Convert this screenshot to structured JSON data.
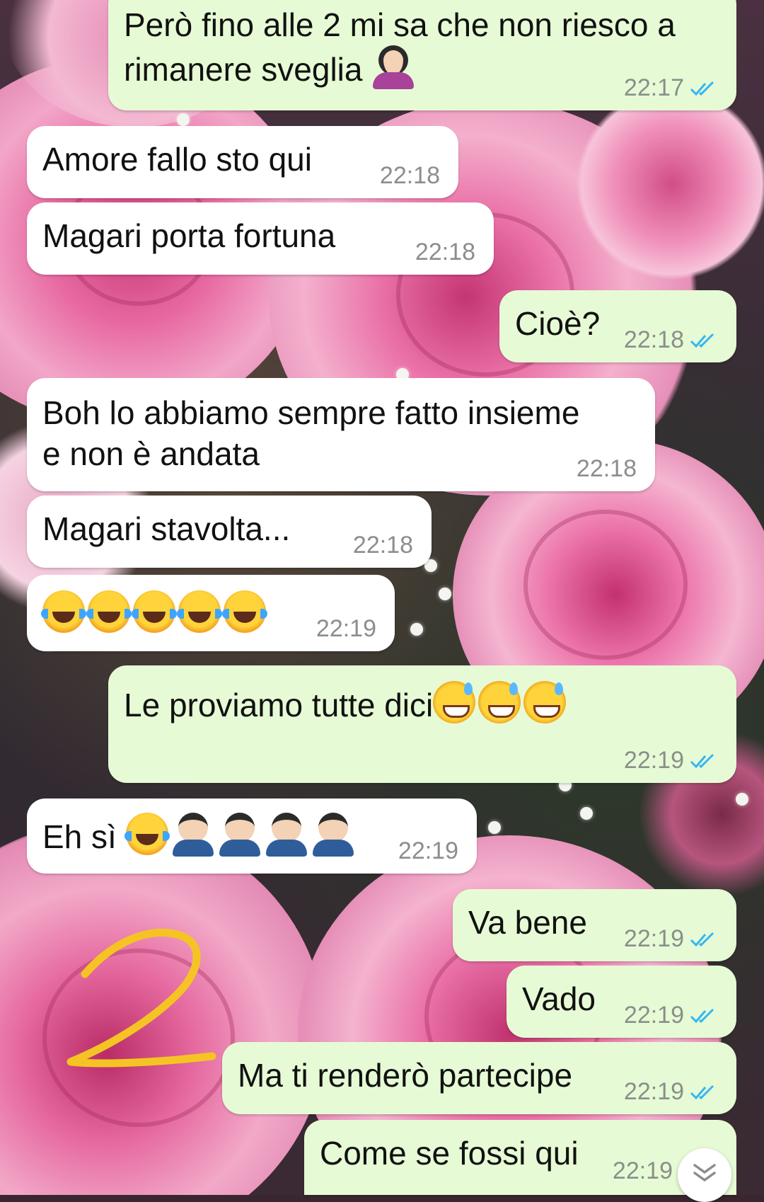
{
  "colors": {
    "incoming_bubble": "#ffffff",
    "outgoing_bubble": "#e6fbd5",
    "timestamp": "#8a8f8a",
    "read_ticks": "#34b7f1",
    "annotation": "#f5c424"
  },
  "messages": [
    {
      "direction": "out",
      "text": "Però fino alle 2 mi sa che non riesco a",
      "text2": "rimanere sveglia",
      "emoji": [
        "facepalm-woman"
      ],
      "time": "22:17",
      "status": "read"
    },
    {
      "direction": "in",
      "text": "Amore fallo sto qui",
      "time": "22:18"
    },
    {
      "direction": "in",
      "text": "Magari porta fortuna",
      "time": "22:18"
    },
    {
      "direction": "out",
      "text": "Cioè?",
      "time": "22:18",
      "status": "read"
    },
    {
      "direction": "in",
      "text": "Boh lo abbiamo sempre fatto insieme",
      "text2": "e non è andata",
      "time": "22:18"
    },
    {
      "direction": "in",
      "text": "Magari stavolta...",
      "time": "22:18"
    },
    {
      "direction": "in",
      "text": "",
      "emoji": [
        "laugh-cry",
        "laugh-cry",
        "laugh-cry",
        "laugh-cry",
        "laugh-cry"
      ],
      "time": "22:19"
    },
    {
      "direction": "out",
      "text": "Le proviamo tutte dici",
      "emoji": [
        "sweat-smile",
        "sweat-smile",
        "sweat-smile"
      ],
      "time": "22:19",
      "status": "read"
    },
    {
      "direction": "in",
      "text": "Eh sì",
      "emoji": [
        "laugh-cry",
        "facepalm-man",
        "facepalm-man",
        "facepalm-man",
        "facepalm-man"
      ],
      "time": "22:19"
    },
    {
      "direction": "out",
      "text": "Va bene",
      "time": "22:19",
      "status": "read"
    },
    {
      "direction": "out",
      "text": "Vado",
      "time": "22:19",
      "status": "read"
    },
    {
      "direction": "out",
      "text": "Ma ti renderò partecipe",
      "time": "22:19",
      "status": "read"
    },
    {
      "direction": "out",
      "text": "Come se fossi qui",
      "time": "22:19",
      "status": "read"
    }
  ],
  "annotation": {
    "text": "2"
  },
  "icons": {
    "read_ticks": "double-check-icon",
    "scroll_down": "double-chevron-down-icon"
  }
}
